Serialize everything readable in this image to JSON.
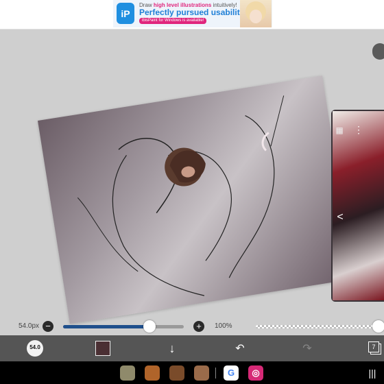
{
  "ad": {
    "logo_text": "iP",
    "line1_pre": "Draw ",
    "line1_highlight": "high level illustrations",
    "line1_post": " intuitively!",
    "line2": "Perfectly pursued usability!",
    "line3": "ibisPaint for Windows is available!"
  },
  "sliders": {
    "brush_size": "54.0px",
    "brush_minus": "−",
    "brush_plus": "+",
    "brush_size_fraction": 0.7,
    "opacity": "100%",
    "opacity_fraction": 1.0
  },
  "toolbar": {
    "brush_label": "54.0",
    "color_hex": "#4a2f33",
    "layer_count": "7"
  },
  "reference": {
    "menu_glyph": "⋮",
    "layer_glyph": "▦",
    "arrow_glyph": "<"
  },
  "nav": {
    "apps": [
      {
        "icon": "game-app-icon-1",
        "color": "#8f8a6b"
      },
      {
        "icon": "game-app-icon-2",
        "color": "#b0642a"
      },
      {
        "icon": "game-app-icon-3",
        "color": "#7a4b2a"
      },
      {
        "icon": "game-app-icon-4",
        "color": "#9a6b4a"
      },
      {
        "icon": "google-icon",
        "color": "#ffffff",
        "glyph": "G"
      },
      {
        "icon": "instagram-icon",
        "color": "#d62976",
        "glyph": "◎"
      }
    ],
    "recents_glyph": "|||"
  }
}
